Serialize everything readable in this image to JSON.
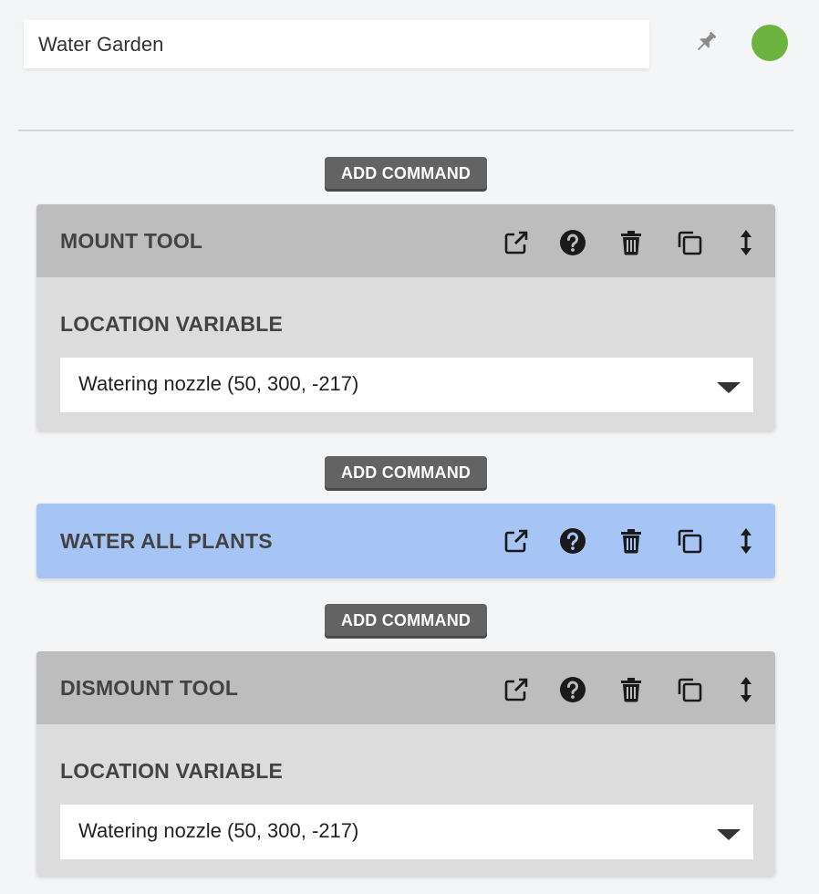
{
  "sequence": {
    "name": "Water Garden",
    "status_color": "#6db33f",
    "pin_icon": "pin-icon"
  },
  "add_command_label": "ADD COMMAND",
  "steps": [
    {
      "title": "MOUNT TOOL",
      "active": false,
      "field_label": "LOCATION VARIABLE",
      "field_value": "Watering nozzle (50, 300, -217)"
    },
    {
      "title": "WATER ALL PLANTS",
      "active": true
    },
    {
      "title": "DISMOUNT TOOL",
      "active": false,
      "field_label": "LOCATION VARIABLE",
      "field_value": "Watering nozzle (50, 300, -217)"
    }
  ],
  "header_icons": [
    "external-link-icon",
    "help-icon",
    "trash-icon",
    "copy-icon",
    "move-vertical-icon"
  ],
  "colors": {
    "active_header": "#a6c4f4",
    "header": "#bdbdbd",
    "body": "#dcdcdc",
    "button": "#636363"
  }
}
